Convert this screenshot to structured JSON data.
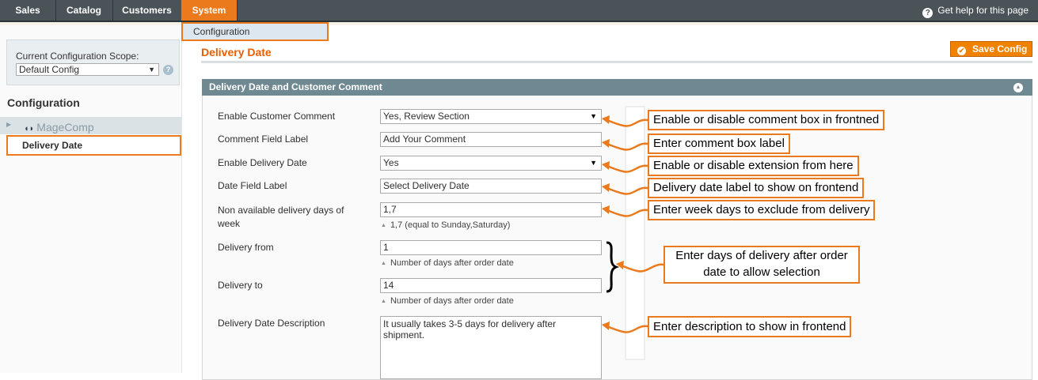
{
  "nav": {
    "items": [
      {
        "label": "Sales",
        "active": false
      },
      {
        "label": "Catalog",
        "active": false
      },
      {
        "label": "Customers",
        "active": false
      },
      {
        "label": "System",
        "active": true
      }
    ],
    "help": "Get help for this page",
    "submenu_item": "Configuration"
  },
  "sidebar": {
    "scope_label": "Current Configuration Scope:",
    "scope_value": "Default Config",
    "title": "Configuration",
    "group_label": "MageComp",
    "selected_item": "Delivery Date"
  },
  "main": {
    "page_title": "Delivery Date",
    "save_label": "Save Config",
    "section_title": "Delivery Date and Customer Comment",
    "fields": {
      "enable_comment": {
        "label": "Enable Customer Comment",
        "value": "Yes, Review Section"
      },
      "comment_label": {
        "label": "Comment Field Label",
        "value": "Add Your Comment"
      },
      "enable_date": {
        "label": "Enable Delivery Date",
        "value": "Yes"
      },
      "date_label": {
        "label": "Date Field Label",
        "value": "Select Delivery Date"
      },
      "non_available": {
        "label": "Non available delivery days of week",
        "value": "1,7",
        "note": "1,7 (equal to Sunday,Saturday)"
      },
      "delivery_from": {
        "label": "Delivery from",
        "value": "1",
        "note": "Number of days after order date"
      },
      "delivery_to": {
        "label": "Delivery to",
        "value": "14",
        "note": "Number of days after order date"
      },
      "description": {
        "label": "Delivery Date Description",
        "value": "It usually takes 3-5 days for delivery after shipment."
      }
    }
  },
  "annotations": {
    "a1": "Enable or disable comment box in frontned",
    "a2": "Enter comment box label",
    "a3": "Enable or disable extension from here",
    "a4": "Delivery date label to show on frontend",
    "a5": "Enter week days to exclude from delivery",
    "a6_line1": "Enter days of delivery after order",
    "a6_line2": "date to allow selection",
    "a7": "Enter description to show in frontend"
  },
  "colors": {
    "accent": "#ea7a1c",
    "nav_bg": "#4a5357",
    "section_header": "#6f8992",
    "title": "#eb5e00"
  }
}
